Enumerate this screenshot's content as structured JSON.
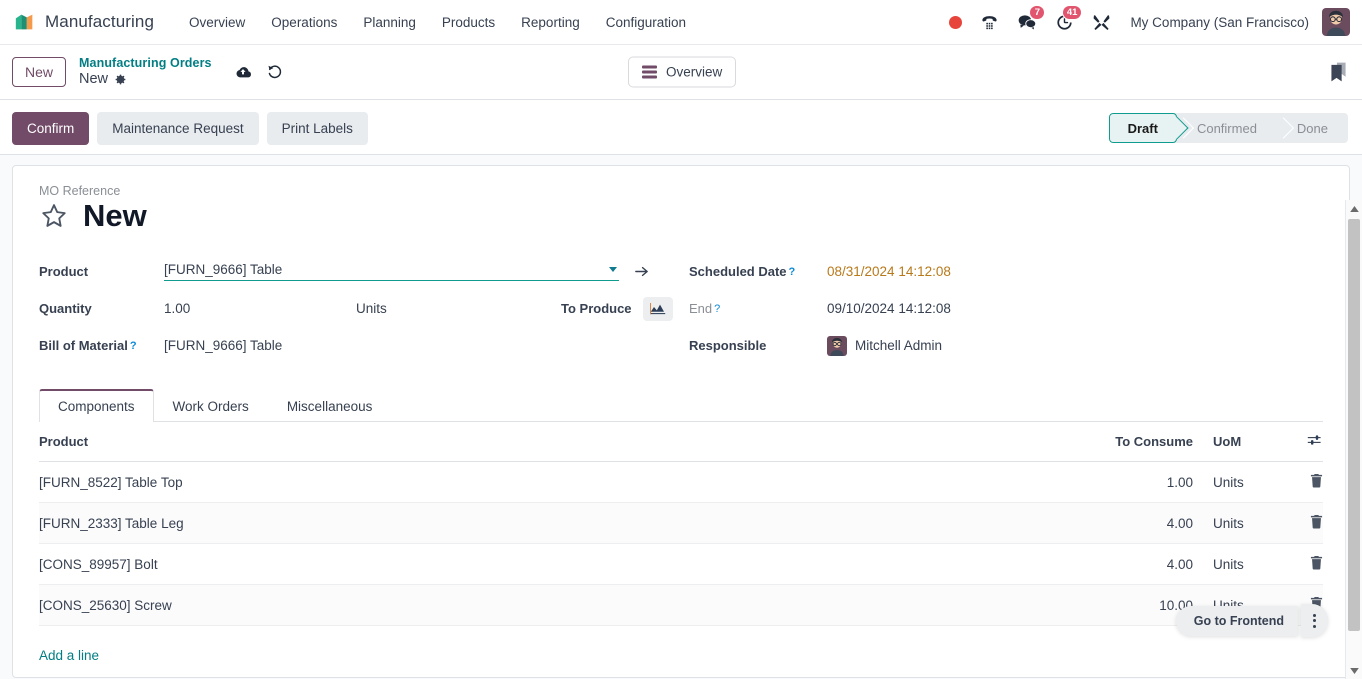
{
  "navbar": {
    "brand": "Manufacturing",
    "menu": [
      {
        "label": "Overview"
      },
      {
        "label": "Operations"
      },
      {
        "label": "Planning"
      },
      {
        "label": "Products"
      },
      {
        "label": "Reporting"
      },
      {
        "label": "Configuration"
      }
    ],
    "systray": {
      "recording_icon": "record-dot-icon",
      "voip_icon": "phone-dialpad-icon",
      "messaging_icon": "chat-bubble-icon",
      "messaging_count": "7",
      "activities_icon": "clock-activity-icon",
      "activities_count": "41",
      "debug_icon": "wrench-tools-icon",
      "company": "My Company (San Francisco)",
      "avatar_icon": "user-avatar"
    }
  },
  "control_panel": {
    "new_button": "New",
    "breadcrumb_parent": "Manufacturing Orders",
    "breadcrumb_current": "New",
    "settings_icon": "gear-icon",
    "save_icon": "cloud-upload-icon",
    "discard_icon": "undo-discard-icon",
    "overview_button": "Overview",
    "overview_icon": "list-view-icon",
    "bookmark_icon": "bookmark-ribbon-icon"
  },
  "statusbar": {
    "buttons": [
      {
        "label": "Confirm",
        "style": "primary"
      },
      {
        "label": "Maintenance Request",
        "style": "secondary"
      },
      {
        "label": "Print Labels",
        "style": "secondary"
      }
    ],
    "stages": [
      {
        "label": "Draft",
        "active": true
      },
      {
        "label": "Confirmed",
        "active": false
      },
      {
        "label": "Done",
        "active": false
      }
    ]
  },
  "form": {
    "reference_label": "MO Reference",
    "favorite_icon": "star-outline-icon",
    "title": "New",
    "left": {
      "product_label": "Product",
      "product_value": "[FURN_9666] Table",
      "product_dropdown_icon": "chevron-down-icon",
      "product_internal_link_icon": "arrow-right-internal-link-icon",
      "quantity_label": "Quantity",
      "quantity_value": "1.00",
      "uom_value": "Units",
      "to_produce_label": "To Produce",
      "to_produce_icon": "area-chart-icon",
      "bom_label": "Bill of Material",
      "bom_value": "[FURN_9666] Table"
    },
    "right": {
      "scheduled_date_label": "Scheduled Date",
      "scheduled_date_value": "08/31/2024 14:12:08",
      "end_label": "End",
      "end_value": "09/10/2024 14:12:08",
      "responsible_label": "Responsible",
      "responsible_value": "Mitchell Admin",
      "responsible_avatar_icon": "user-avatar"
    },
    "help_marker": "?"
  },
  "notebook": {
    "tabs": [
      {
        "label": "Components",
        "active": true
      },
      {
        "label": "Work Orders",
        "active": false
      },
      {
        "label": "Miscellaneous",
        "active": false
      }
    ]
  },
  "components_table": {
    "columns": {
      "product": "Product",
      "to_consume": "To Consume",
      "uom": "UoM",
      "optional_columns_icon": "sliders-toggle-icon"
    },
    "rows": [
      {
        "product": "[FURN_8522] Table Top",
        "to_consume": "1.00",
        "uom": "Units",
        "delete_icon": "trash-icon"
      },
      {
        "product": "[FURN_2333] Table Leg",
        "to_consume": "4.00",
        "uom": "Units",
        "delete_icon": "trash-icon"
      },
      {
        "product": "[CONS_89957] Bolt",
        "to_consume": "4.00",
        "uom": "Units",
        "delete_icon": "trash-icon"
      },
      {
        "product": "[CONS_25630] Screw",
        "to_consume": "10.00",
        "uom": "Units",
        "delete_icon": "trash-icon"
      }
    ],
    "add_line": "Add a line"
  },
  "frontend_widget": {
    "label": "Go to Frontend",
    "menu_icon": "vertical-dots-icon"
  },
  "scrollbar": {
    "up_icon": "scroll-up-arrow-icon",
    "down_icon": "scroll-down-arrow-icon"
  },
  "colors": {
    "primary": "#714b67",
    "link": "#017e84",
    "accent_teal": "#0f9b8e",
    "warning": "#b8791b",
    "badge": "#e1556e",
    "record": "#e7443b"
  }
}
